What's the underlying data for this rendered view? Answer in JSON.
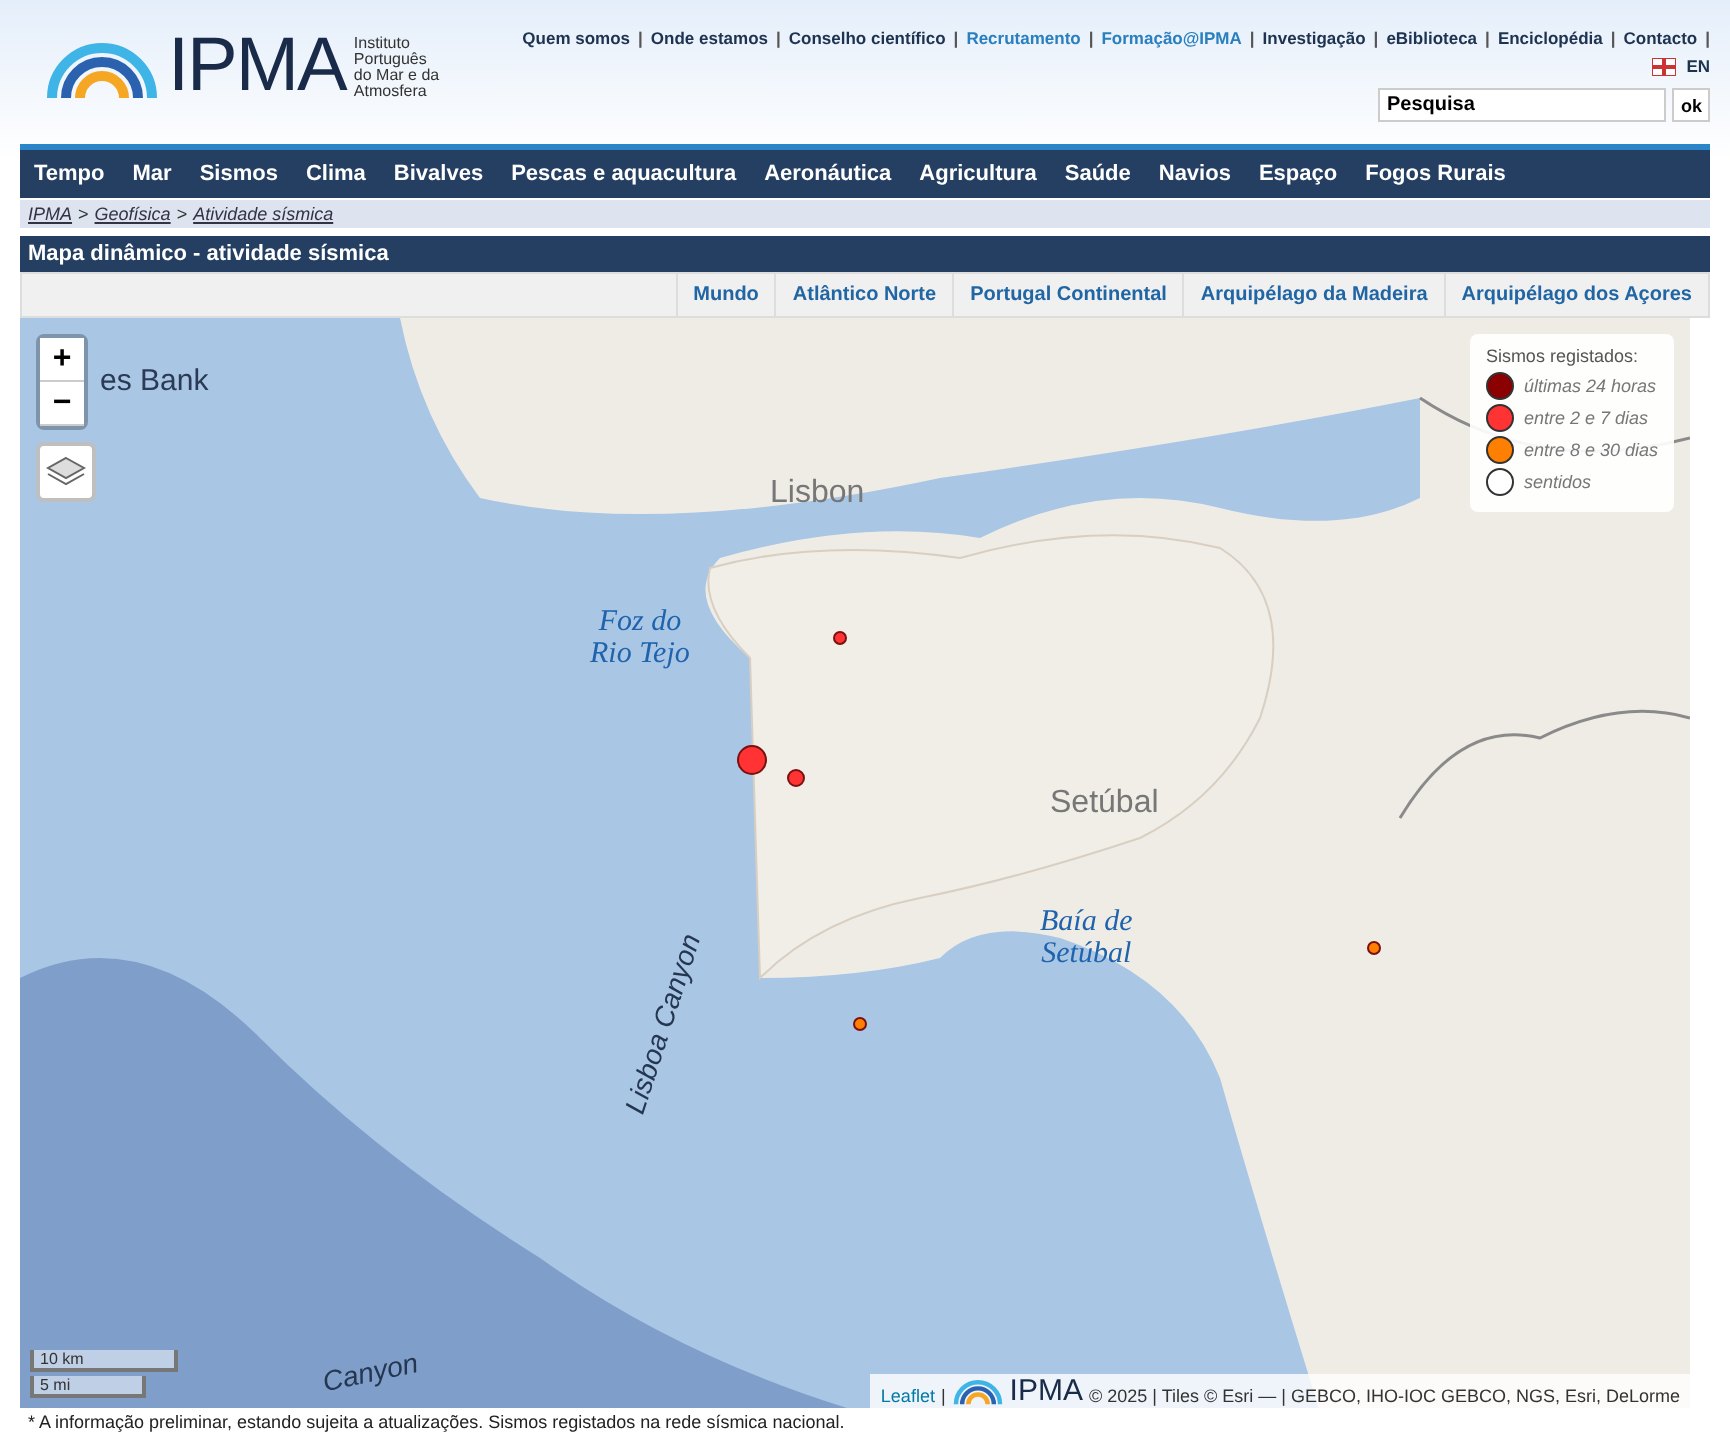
{
  "logo": {
    "name": "IPMA",
    "subtitle": "Instituto Português do Mar e da Atmosfera"
  },
  "top_links": [
    {
      "label": "Quem somos",
      "accent": false,
      "separator": "|"
    },
    {
      "label": "Onde estamos",
      "accent": false,
      "separator": "|"
    },
    {
      "label": "Conselho científico",
      "accent": false,
      "separator": "|"
    },
    {
      "label": "Recrutamento",
      "accent": true,
      "separator": "|"
    },
    {
      "label": "Formação@IPMA",
      "accent": true,
      "separator": "|"
    },
    {
      "label": "Investigação",
      "accent": false,
      "separator": "|"
    },
    {
      "label": "eBiblioteca",
      "accent": false,
      "separator": "|"
    },
    {
      "label": "Enciclopédia",
      "accent": false,
      "separator": "|"
    },
    {
      "label": "Contacto",
      "accent": false,
      "separator": "|"
    }
  ],
  "language": "EN",
  "search": {
    "value": "Pesquisa",
    "button": "ok"
  },
  "main_nav": [
    "Tempo",
    "Mar",
    "Sismos",
    "Clima",
    "Bivalves",
    "Pescas e aquacultura",
    "Aeronáutica",
    "Agricultura",
    "Saúde",
    "Navios",
    "Espaço",
    "Fogos Rurais"
  ],
  "breadcrumb": [
    "IPMA",
    "Geofísica",
    "Atividade sísmica"
  ],
  "breadcrumb_separator": ">",
  "panel_title": "Mapa dinâmico - atividade sísmica",
  "region_tabs": [
    "Mundo",
    "Atlântico Norte",
    "Portugal Continental",
    "Arquipélago da Madeira",
    "Arquipélago dos Açores"
  ],
  "map": {
    "zoom_in": "+",
    "zoom_out": "−",
    "labels": [
      {
        "text": "es Bank",
        "kind": "place"
      },
      {
        "text": "Lisbon",
        "kind": "city"
      },
      {
        "text": "Foz do\nRio Tejo",
        "kind": "water"
      },
      {
        "text": "Setúbal",
        "kind": "city"
      },
      {
        "text": "Baía de\nSetúbal",
        "kind": "water"
      },
      {
        "text": "Lisboa Canyon",
        "kind": "seafloor"
      },
      {
        "text": "Canyon",
        "kind": "seafloor"
      }
    ],
    "legend": {
      "title": "Sismos registados:",
      "items": [
        {
          "label": "últimas 24 horas",
          "color": "#8b0000"
        },
        {
          "label": "entre 2 e 7 dias",
          "color": "#ff3333"
        },
        {
          "label": "entre 8 e 30 dias",
          "color": "#ff8000"
        },
        {
          "label": "sentidos",
          "color": "#ffffff"
        }
      ]
    },
    "quakes": [
      {
        "color": "#ff3333",
        "kind": "large"
      },
      {
        "color": "#ff3333",
        "kind": "medium"
      },
      {
        "color": "#ff3333",
        "kind": "small"
      },
      {
        "color": "#ff8000",
        "kind": "small"
      },
      {
        "color": "#ff8000",
        "kind": "small"
      }
    ],
    "scale": [
      "10 km",
      "5 mi"
    ],
    "attribution": {
      "link": "Leaflet",
      "separator": "|",
      "logo": "IPMA",
      "text": "© 2025 | Tiles © Esri — | GEBCO, IHO-IOC GEBCO, NGS, Esri, DeLorme"
    }
  },
  "footnote": "* A informação preliminar, estando sujeita a atualizações. Sismos registados na rede sísmica nacional."
}
